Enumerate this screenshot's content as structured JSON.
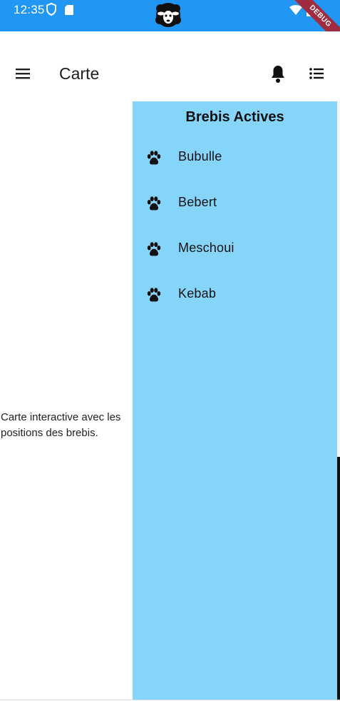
{
  "status_bar": {
    "time": "12:35",
    "debug_label": "DEBUG"
  },
  "app_bar": {
    "title": "Carte",
    "icons": {
      "menu": "menu-icon",
      "notification": "bell-icon",
      "list": "list-icon"
    }
  },
  "map": {
    "description": "Carte interactive avec les positions des brebis."
  },
  "panel": {
    "title": "Brebis Actives",
    "items": [
      {
        "name": "Bubulle",
        "icon": "paw-icon"
      },
      {
        "name": "Bebert",
        "icon": "paw-icon"
      },
      {
        "name": "Meschoui",
        "icon": "paw-icon"
      },
      {
        "name": "Kebab",
        "icon": "paw-icon"
      }
    ]
  },
  "colors": {
    "status_bar": "#2196f3",
    "panel_background": "#84d5f9",
    "debug_ribbon": "#a02d3f"
  }
}
